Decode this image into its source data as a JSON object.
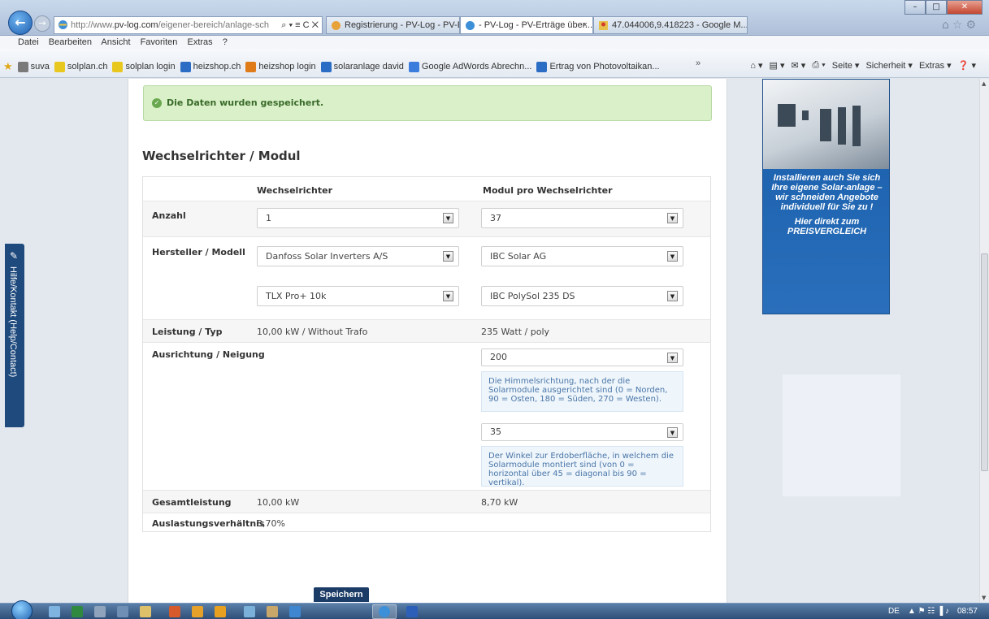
{
  "browser": {
    "address": {
      "prefix": "http://www.",
      "domain": "pv-log.com",
      "path": "/eigener-bereich/anlage-sch",
      "tools": "⌕ ▾ ≡ C ✕"
    },
    "tabs": [
      {
        "label": "Registrierung - PV-Log - PV-Er..."
      },
      {
        "label": "- PV-Log - PV-Erträge über...",
        "close": "×"
      },
      {
        "label": "47.044006,9.418223 - Google M..."
      }
    ],
    "window_buttons": {
      "minimize": "–",
      "maximize": "□",
      "close": "✕"
    },
    "top_icons": "⌂☆⚙",
    "menu": [
      "Datei",
      "Bearbeiten",
      "Ansicht",
      "Favoriten",
      "Extras",
      "?"
    ],
    "favorites": [
      {
        "label": "suva",
        "color": "#7a7a7a"
      },
      {
        "label": "solplan.ch",
        "color": "#e8c81e"
      },
      {
        "label": "solplan login",
        "color": "#e8c81e"
      },
      {
        "label": "heizshop.ch",
        "color": "#2b6cc4"
      },
      {
        "label": "heizshop login",
        "color": "#e07b1a"
      },
      {
        "label": "solaranlage david",
        "color": "#2b6cc4"
      },
      {
        "label": "Google AdWords Abrechn...",
        "color": "#3b7ddd"
      },
      {
        "label": "Ertrag von Photovoltaikan...",
        "color": "#2b6cc4"
      }
    ],
    "favorites_more": "»",
    "command_bar": {
      "home": "⌂ ▾",
      "feeds": "▤ ▾",
      "mail": "✉ ▾",
      "print": "⎙ ▾",
      "page": "Seite ▾",
      "safety": "Sicherheit ▾",
      "tools": "Extras ▾",
      "help": "❓ ▾"
    }
  },
  "page": {
    "success_message": "Die Daten wurden gespeichert.",
    "section_title": "Wechselrichter / Modul",
    "columns": {
      "inverter": "Wechselrichter",
      "module": "Modul pro Wechselrichter"
    },
    "rows": {
      "anzahl": {
        "label": "Anzahl",
        "inverter_value": "1",
        "module_value": "37"
      },
      "hersteller": {
        "label": "Hersteller / Modell",
        "inverter_maker": "Danfoss Solar Inverters A/S",
        "inverter_model": "TLX Pro+ 10k",
        "module_maker": "IBC Solar AG",
        "module_model": "IBC PolySol 235 DS"
      },
      "leistung": {
        "label": "Leistung / Typ",
        "inverter_value": "10,00 kW / Without Trafo",
        "module_value": "235 Watt / poly"
      },
      "ausrichtung": {
        "label": "Ausrichtung / Neigung",
        "orientation_value": "200",
        "orientation_hint": "Die Himmelsrichtung, nach der die Solarmodule ausgerichtet sind (0 = Norden, 90 = Osten, 180 = Süden, 270 = Westen).",
        "tilt_value": "35",
        "tilt_hint": "Der Winkel zur Erdoberfläche, in welchem die Solarmodule montiert sind (von 0 = horizontal über 45 = diagonal bis 90 = vertikal)."
      },
      "gesamtleistung": {
        "label": "Gesamtleistung",
        "inverter_value": "10,00 kW",
        "module_value": "8,70 kW"
      },
      "auslastung": {
        "label": "Auslastungsverhältnis",
        "value": "8,70%"
      }
    },
    "save_button": "Speichern",
    "feedback_tab": "Hilfe/Kontakt (Help/Contact)",
    "ad": {
      "line1": "Installieren auch Sie sich Ihre eigene Solar-anlage – wir schneiden Angebote individuell für Sie zu !",
      "cta": "Hier direkt zum PREISVERGLEICH"
    }
  },
  "taskbar": {
    "language": "DE",
    "tray_icons": "▲ ⚑ ☷ ▐ ♪",
    "time": "08:57"
  },
  "colors": {
    "success_bg": "#d9f0c8",
    "hint_text": "#4a76a8",
    "ad_blue": "#1f64b0",
    "side_tab": "#1f4a7d"
  }
}
